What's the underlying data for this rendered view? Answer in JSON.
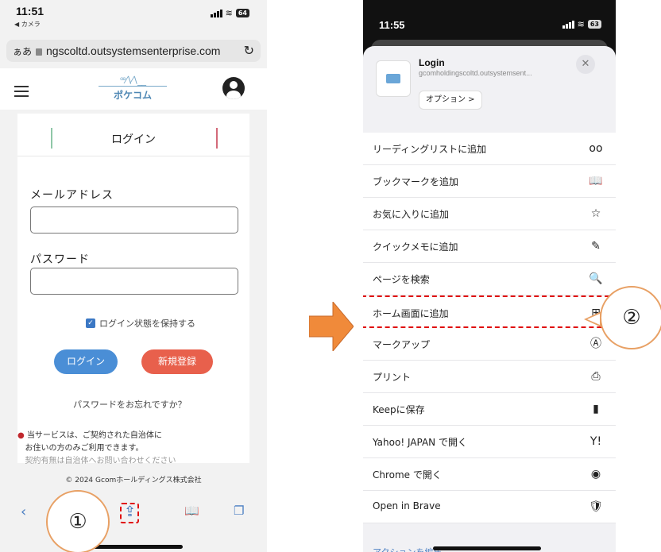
{
  "left_phone": {
    "status": {
      "time": "11:51",
      "back_app": "◀ カメラ",
      "battery": "64"
    },
    "url_bar": {
      "aa": "ぁあ",
      "url": "ngscoltd.outsystemsenterprise.com"
    },
    "header": {
      "logo_text": "ポケコム"
    },
    "page": {
      "title": "ログイン",
      "email_label": "メールアドレス",
      "password_label": "パスワード",
      "remember_label": "ログイン状態を保持する",
      "login_button": "ログイン",
      "register_button": "新規登録",
      "forgot_link": "パスワードをお忘れですか？",
      "notice_line1": "当サービスは、ご契約された自治体に",
      "notice_line2": "お住いの方のみご利用できます。",
      "notice_line3": "契約有無は自治体へお問い合わせください"
    },
    "footer": {
      "copyright": "© 2024 Gcomホールディングス株式会社"
    }
  },
  "callouts": {
    "step1": "①",
    "step2": "②"
  },
  "right_phone": {
    "status": {
      "time": "11:55",
      "battery": "63"
    },
    "share_header": {
      "title": "Login",
      "subtitle": "gcomholdingscoltd.outsystemsent...",
      "options_button": "オプション >"
    },
    "menu_items": [
      {
        "label": "リーディングリストに追加",
        "icon": "glasses-icon",
        "glyph": "oo",
        "highlight": false
      },
      {
        "label": "ブックマークを追加",
        "icon": "book-icon",
        "glyph": "📖",
        "highlight": false
      },
      {
        "label": "お気に入りに追加",
        "icon": "star-icon",
        "glyph": "☆",
        "highlight": false
      },
      {
        "label": "クイックメモに追加",
        "icon": "quick-note-icon",
        "glyph": "✎",
        "highlight": false
      },
      {
        "label": "ページを検索",
        "icon": "find-in-page-icon",
        "glyph": "🔍",
        "highlight": false
      },
      {
        "label": "ホーム画面に追加",
        "icon": "add-square-icon",
        "glyph": "⊞",
        "highlight": true
      },
      {
        "label": "マークアップ",
        "icon": "markup-icon",
        "glyph": "Ⓐ",
        "highlight": false
      },
      {
        "label": "プリント",
        "icon": "printer-icon",
        "glyph": "⎙",
        "highlight": false
      },
      {
        "label": "Keepに保存",
        "icon": "bookmark-icon",
        "glyph": "▮",
        "highlight": false
      },
      {
        "label": "Yahoo! JAPAN で開く",
        "icon": "yahoo-icon",
        "glyph": "Y!",
        "highlight": false
      },
      {
        "label": "Chrome で開く",
        "icon": "chrome-icon",
        "glyph": "◉",
        "highlight": false
      },
      {
        "label": "Open in Brave",
        "icon": "brave-icon",
        "glyph": "🛡",
        "highlight": false
      }
    ],
    "actions_link": "アクションを編集..."
  },
  "colors": {
    "accent_blue": "#4a8ed6",
    "danger_red": "#e01010",
    "arrow_orange": "#f08a3a",
    "callout_border": "#e8a064"
  }
}
